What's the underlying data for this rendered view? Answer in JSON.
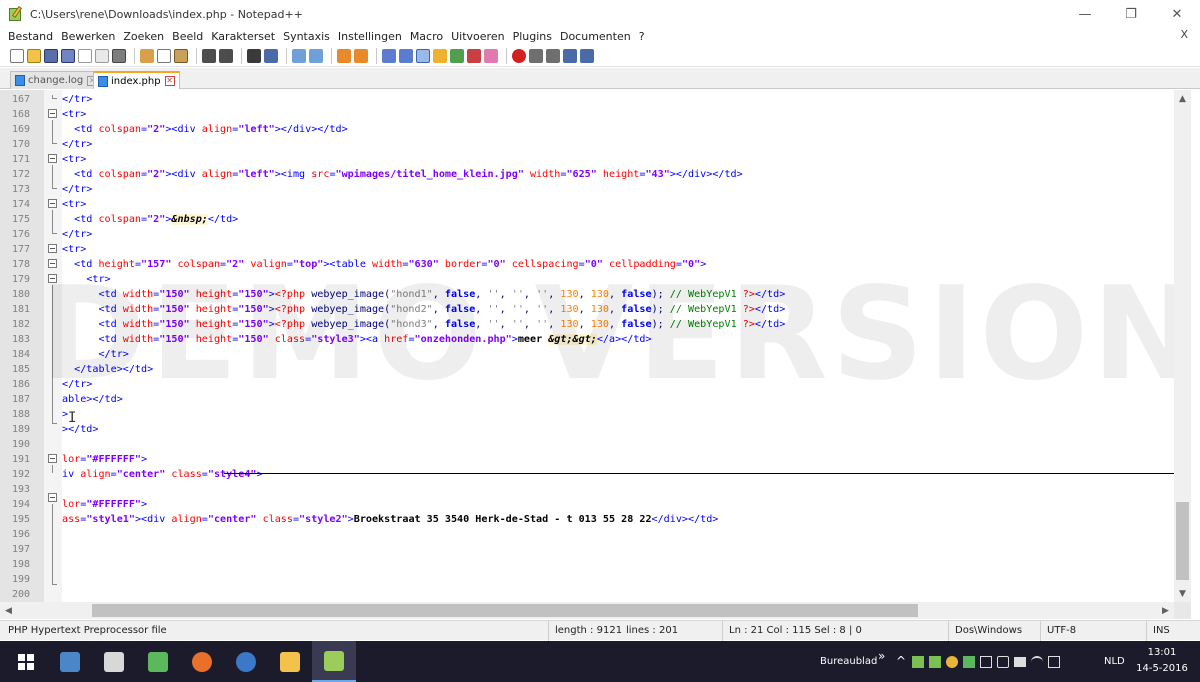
{
  "window": {
    "title": "C:\\Users\\rene\\Downloads\\index.php - Notepad++",
    "controls": {
      "minimize": "—",
      "maximize": "❐",
      "close": "✕"
    }
  },
  "menu": {
    "items": [
      "Bestand",
      "Bewerken",
      "Zoeken",
      "Beeld",
      "Karakterset",
      "Syntaxis",
      "Instellingen",
      "Macro",
      "Uitvoeren",
      "Plugins",
      "Documenten",
      "?"
    ],
    "close_doc": "X"
  },
  "tabs": [
    {
      "label": "change.log",
      "active": false
    },
    {
      "label": "index.php",
      "active": true
    }
  ],
  "editor": {
    "watermark": "DEMO VERSION",
    "lines": [
      {
        "n": "167",
        "html": "<span class='t-tag'>&lt;/tr&gt;</span>"
      },
      {
        "n": "168",
        "html": "<span class='t-tag'>&lt;tr&gt;</span>"
      },
      {
        "n": "169",
        "html": "  <span class='t-tag'>&lt;td </span><span class='t-attr'>colspan</span><span class='t-tag'>=</span><span class='t-val'>\"2\"</span><span class='t-tag'>&gt;&lt;div </span><span class='t-attr'>align</span><span class='t-tag'>=</span><span class='t-val'>\"left\"</span><span class='t-tag'>&gt;&lt;/div&gt;&lt;/td&gt;</span>"
      },
      {
        "n": "170",
        "html": "<span class='t-tag'>&lt;/tr&gt;</span>"
      },
      {
        "n": "171",
        "html": "<span class='t-tag'>&lt;tr&gt;</span>"
      },
      {
        "n": "172",
        "html": "  <span class='t-tag'>&lt;td </span><span class='t-attr'>colspan</span><span class='t-tag'>=</span><span class='t-val'>\"2\"</span><span class='t-tag'>&gt;&lt;div </span><span class='t-attr'>align</span><span class='t-tag'>=</span><span class='t-val'>\"left\"</span><span class='t-tag'>&gt;&lt;img </span><span class='t-attr'>src</span><span class='t-tag'>=</span><span class='t-val'>\"wpimages/titel_home_klein.jpg\"</span><span class='t-tag'> </span><span class='t-attr'>width</span><span class='t-tag'>=</span><span class='t-val'>\"625\"</span><span class='t-tag'> </span><span class='t-attr'>height</span><span class='t-tag'>=</span><span class='t-val'>\"43\"</span><span class='t-tag'>&gt;&lt;/div&gt;&lt;/td&gt;</span>"
      },
      {
        "n": "173",
        "html": "<span class='t-tag'>&lt;/tr&gt;</span>"
      },
      {
        "n": "174",
        "html": "<span class='t-tag'>&lt;tr&gt;</span>"
      },
      {
        "n": "175",
        "html": "  <span class='t-tag'>&lt;td </span><span class='t-attr'>colspan</span><span class='t-tag'>=</span><span class='t-val'>\"2\"</span><span class='t-tag'>&gt;</span><span class='t-ent'>&amp;nbsp;</span><span class='t-tag'>&lt;/td&gt;</span>"
      },
      {
        "n": "176",
        "html": "<span class='t-tag'>&lt;/tr&gt;</span>"
      },
      {
        "n": "177",
        "html": "<span class='t-tag'>&lt;tr&gt;</span>"
      },
      {
        "n": "178",
        "html": "  <span class='t-tag'>&lt;td </span><span class='t-attr'>height</span><span class='t-tag'>=</span><span class='t-val'>\"157\"</span><span class='t-tag'> </span><span class='t-attr'>colspan</span><span class='t-tag'>=</span><span class='t-val'>\"2\"</span><span class='t-tag'> </span><span class='t-attr'>valign</span><span class='t-tag'>=</span><span class='t-val'>\"top\"</span><span class='t-tag'>&gt;&lt;table </span><span class='t-attr'>width</span><span class='t-tag'>=</span><span class='t-val'>\"630\"</span><span class='t-tag'> </span><span class='t-attr'>border</span><span class='t-tag'>=</span><span class='t-val'>\"0\"</span><span class='t-tag'> </span><span class='t-attr'>cellspacing</span><span class='t-tag'>=</span><span class='t-val'>\"0\"</span><span class='t-tag'> </span><span class='t-attr'>cellpadding</span><span class='t-tag'>=</span><span class='t-val'>\"0\"</span><span class='t-tag'>&gt;</span>"
      },
      {
        "n": "179",
        "html": "    <span class='t-tag'>&lt;tr&gt;</span>"
      },
      {
        "n": "180",
        "html": "      <span class='t-tag'>&lt;td </span><span class='t-attr'>width</span><span class='t-tag'>=</span><span class='t-val'>\"150\"</span><span class='t-tag'> </span><span class='t-attr'>height</span><span class='t-tag'>=</span><span class='t-val'>\"150\"</span><span class='t-tag'>&gt;</span><span class='t-php'>&lt;?php</span><span class='t-fn'> webyep_image(</span><span class='t-str'>\"hond1\"</span><span class='t-fn'>, </span><span class='t-kw'>false</span><span class='t-fn'>, </span><span class='t-str'>''</span><span class='t-fn'>, </span><span class='t-str'>''</span><span class='t-fn'>, </span><span class='t-str'>''</span><span class='t-fn'>, </span><span class='t-num'>130</span><span class='t-fn'>, </span><span class='t-num'>130</span><span class='t-fn'>, </span><span class='t-kw'>false</span><span class='t-fn'>); </span><span class='t-cm'>// WebYepV1 </span><span class='t-php'>?&gt;</span><span class='t-tag'>&lt;/td&gt;</span>"
      },
      {
        "n": "181",
        "html": "      <span class='t-tag'>&lt;td </span><span class='t-attr'>width</span><span class='t-tag'>=</span><span class='t-val'>\"150\"</span><span class='t-tag'> </span><span class='t-attr'>height</span><span class='t-tag'>=</span><span class='t-val'>\"150\"</span><span class='t-tag'>&gt;</span><span class='t-php'>&lt;?php</span><span class='t-fn'> webyep_image(</span><span class='t-str'>\"hond2\"</span><span class='t-fn'>, </span><span class='t-kw'>false</span><span class='t-fn'>, </span><span class='t-str'>''</span><span class='t-fn'>, </span><span class='t-str'>''</span><span class='t-fn'>, </span><span class='t-str'>''</span><span class='t-fn'>, </span><span class='t-num'>130</span><span class='t-fn'>, </span><span class='t-num'>130</span><span class='t-fn'>, </span><span class='t-kw'>false</span><span class='t-fn'>); </span><span class='t-cm'>// WebYepV1 </span><span class='t-php'>?&gt;</span><span class='t-tag'>&lt;/td&gt;</span>"
      },
      {
        "n": "182",
        "html": "      <span class='t-tag'>&lt;td </span><span class='t-attr'>width</span><span class='t-tag'>=</span><span class='t-val'>\"150\"</span><span class='t-tag'> </span><span class='t-attr'>height</span><span class='t-tag'>=</span><span class='t-val'>\"150\"</span><span class='t-tag'>&gt;</span><span class='t-php'>&lt;?php</span><span class='t-fn'> webyep_image(</span><span class='t-str'>\"hond3\"</span><span class='t-fn'>, </span><span class='t-kw'>false</span><span class='t-fn'>, </span><span class='t-str'>''</span><span class='t-fn'>, </span><span class='t-str'>''</span><span class='t-fn'>, </span><span class='t-str'>''</span><span class='t-fn'>, </span><span class='t-num'>130</span><span class='t-fn'>, </span><span class='t-num'>130</span><span class='t-fn'>, </span><span class='t-kw'>false</span><span class='t-fn'>); </span><span class='t-cm'>// WebYepV1 </span><span class='t-php'>?&gt;</span><span class='t-tag'>&lt;/td&gt;</span>"
      },
      {
        "n": "183",
        "html": "      <span class='t-tag'>&lt;td </span><span class='t-attr'>width</span><span class='t-tag'>=</span><span class='t-val'>\"150\"</span><span class='t-tag'> </span><span class='t-attr'>height</span><span class='t-tag'>=</span><span class='t-val'>\"150\"</span><span class='t-tag'> </span><span class='t-attr'>class</span><span class='t-tag'>=</span><span class='t-val'>\"style3\"</span><span class='t-tag'>&gt;&lt;a </span><span class='t-attr'>href</span><span class='t-tag'>=</span><span class='t-val'>\"onzehonden.php\"</span><span class='t-tag'>&gt;</span><span class='t-txt'>meer </span><span class='t-ent'>&amp;gt;&amp;gt;</span><span class='t-tag'>&lt;/a&gt;&lt;/td&gt;</span>"
      },
      {
        "n": "184",
        "html": "      <span class='t-tag'>&lt;/tr&gt;</span>"
      },
      {
        "n": "185",
        "html": "  <span class='t-tag'>&lt;/table&gt;&lt;/td&gt;</span>"
      },
      {
        "n": "186",
        "html": "<span class='t-tag'>&lt;/tr&gt;</span>"
      },
      {
        "n": "187",
        "html": "<span class='t-tag'>able&gt;&lt;/td&gt;</span>"
      },
      {
        "n": "188",
        "html": "<span class='t-tag'>&gt;</span>"
      },
      {
        "n": "189",
        "html": "<span class='t-tag'>&gt;&lt;/td&gt;</span>"
      },
      {
        "n": "190",
        "html": ""
      },
      {
        "n": "191",
        "html": "<span class='t-attr'>lor</span><span class='t-tag'>=</span><span class='t-val'>\"#FFFFFF\"</span><span class='t-tag'>&gt;</span>"
      },
      {
        "n": "192",
        "html": "<span class='t-tag'>iv </span><span class='t-attr'>align</span><span class='t-tag'>=</span><span class='t-val'>\"center\"</span><span class='t-tag'> </span><span class='t-attr'>class</span><span class='t-tag'>=</span><span class='t-val'>\"style4\"</span><span class='t-tag'>&gt;</span>"
      },
      {
        "n": "193",
        "html": ""
      },
      {
        "n": "194",
        "html": "<span class='t-attr'>lor</span><span class='t-tag'>=</span><span class='t-val'>\"#FFFFFF\"</span><span class='t-tag'>&gt;</span>"
      },
      {
        "n": "195",
        "html": "<span class='t-attr'>ass</span><span class='t-tag'>=</span><span class='t-val'>\"style1\"</span><span class='t-tag'>&gt;&lt;div </span><span class='t-attr'>align</span><span class='t-tag'>=</span><span class='t-val'>\"center\"</span><span class='t-tag'> </span><span class='t-attr'>class</span><span class='t-tag'>=</span><span class='t-val'>\"style2\"</span><span class='t-tag'>&gt;</span><span class='t-txt'>Broekstraat 35 3540 Herk-de-Stad - t 013 55 28 22</span><span class='t-tag'>&lt;/div&gt;&lt;/td&gt;</span>"
      },
      {
        "n": "196",
        "html": ""
      },
      {
        "n": "197",
        "html": ""
      },
      {
        "n": "198",
        "html": ""
      },
      {
        "n": "199",
        "html": ""
      },
      {
        "n": "200",
        "html": ""
      },
      {
        "n": "201",
        "html": ""
      }
    ]
  },
  "status": {
    "file_type": "PHP Hypertext Preprocessor file",
    "length": "length : 9121",
    "lines": "lines : 201",
    "position": "Ln : 21   Col : 115   Sel : 8 | 0",
    "eol": "Dos\\Windows",
    "encoding": "UTF-8",
    "mode": "INS"
  },
  "taskbar": {
    "desktop_label": "Bureaublad",
    "chevron": "»",
    "language": "NLD",
    "time": "13:01",
    "date": "14-5-2016"
  },
  "colors": {
    "tag": "#0000ff",
    "attribute": "#ff0000",
    "value": "#8000ff",
    "comment": "#008000",
    "number": "#ff8000",
    "taskbar": "#1b1b2b"
  }
}
